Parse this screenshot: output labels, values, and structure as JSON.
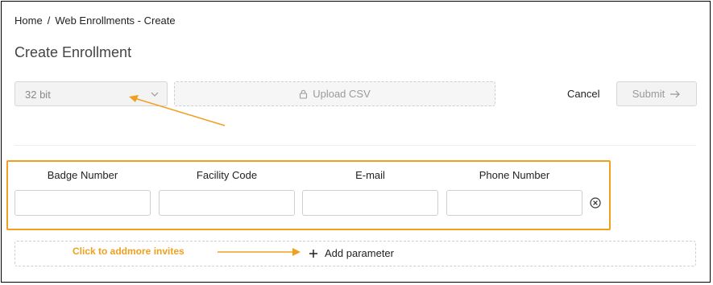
{
  "breadcrumb": {
    "home": "Home",
    "separator": "/",
    "current": "Web Enrollments - Create"
  },
  "page_title": "Create Enrollment",
  "toolbar": {
    "select_value": "32 bit",
    "upload_label": "Upload CSV",
    "cancel_label": "Cancel",
    "submit_label": "Submit"
  },
  "invite_form": {
    "columns": [
      "Badge Number",
      "Facility Code",
      "E-mail",
      "Phone Number"
    ],
    "values": [
      "",
      "",
      "",
      ""
    ]
  },
  "add_parameter_label": "Add parameter",
  "annotation": {
    "hint_text": "Click to addmore invites",
    "color": "#f0a020"
  },
  "icons": {
    "select": "chevron-down-icon",
    "upload": "lock-icon",
    "submit": "arrow-right-icon",
    "remove": "circle-x-icon",
    "add": "plus-icon"
  }
}
